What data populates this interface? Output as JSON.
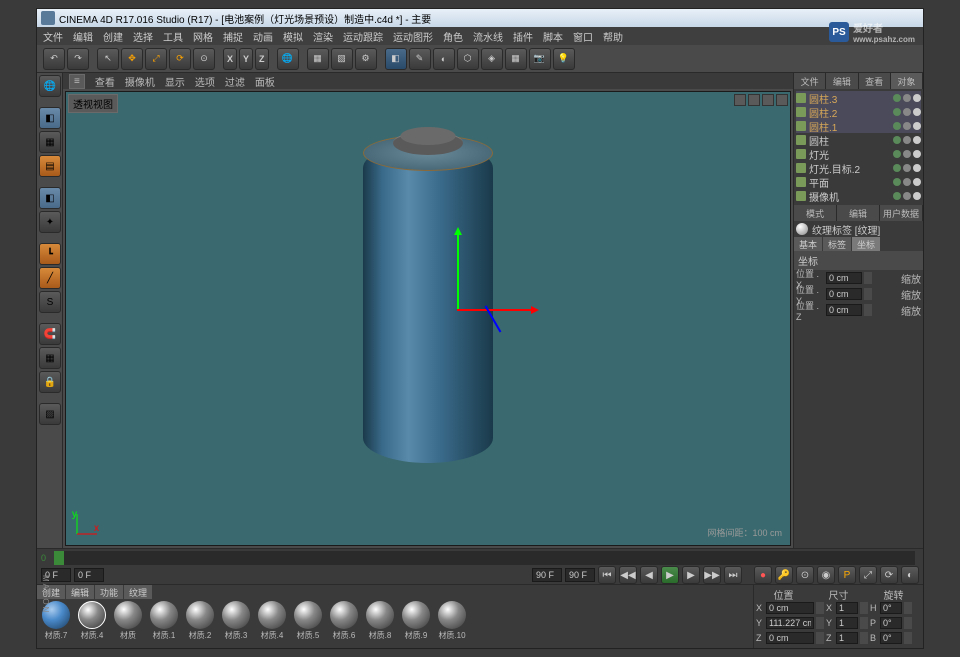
{
  "title": "CINEMA 4D R17.016 Studio (R17) - [电池案例（灯光场景预设）制造中.c4d *] - 主要",
  "menu": [
    "文件",
    "编辑",
    "创建",
    "选择",
    "工具",
    "网格",
    "捕捉",
    "动画",
    "模拟",
    "渲染",
    "运动跟踪",
    "运动图形",
    "角色",
    "流水线",
    "插件",
    "脚本",
    "窗口",
    "帮助"
  ],
  "toolbar_xyz": [
    "X",
    "Y",
    "Z"
  ],
  "viewport": {
    "menu": [
      "查看",
      "摄像机",
      "显示",
      "选项",
      "过滤",
      "面板"
    ],
    "label": "透视视图",
    "grid_label": "网格间距：100 cm"
  },
  "right": {
    "tabs": [
      "文件",
      "编辑",
      "查看",
      "对象"
    ],
    "objects": [
      {
        "name": "圆柱.3",
        "sel": true
      },
      {
        "name": "圆柱.2",
        "sel": true
      },
      {
        "name": "圆柱.1",
        "sel": true
      },
      {
        "name": "圆柱",
        "sel": false
      },
      {
        "name": "灯光",
        "sel": false
      },
      {
        "name": "灯光.目标.2",
        "sel": false
      },
      {
        "name": "平面",
        "sel": false
      },
      {
        "name": "摄像机",
        "sel": false
      }
    ],
    "attr_tabs": [
      "模式",
      "编辑",
      "用户数据"
    ],
    "attr_title": "纹理标签 [纹理]",
    "attr_subtabs": [
      "基本",
      "标签",
      "坐标"
    ],
    "attr_section": "坐标",
    "attr_rows": [
      {
        "l": "位置 . X",
        "v": "0 cm",
        "r": "缩放"
      },
      {
        "l": "位置 . Y",
        "v": "0 cm",
        "r": "缩放"
      },
      {
        "l": "位置 . Z",
        "v": "0 cm",
        "r": "缩放"
      }
    ]
  },
  "timeline": {
    "start_field": "0 F",
    "current": "0",
    "end_field": "90 F",
    "range": "90 F"
  },
  "mat_tabs": [
    "创建",
    "编辑",
    "功能",
    "纹理"
  ],
  "materials": [
    "材质.7",
    "材质.4",
    "材质",
    "材质.1",
    "材质.2",
    "材质.3",
    "材质.4",
    "材质.5",
    "材质.6",
    "材质.8",
    "材质.9",
    "材质.10"
  ],
  "coord": {
    "headers": [
      "位置",
      "尺寸",
      "旋转"
    ],
    "rows": [
      {
        "a": "X",
        "p": "0 cm",
        "s": "X",
        "sv": "1",
        "r": "H",
        "rv": "0°"
      },
      {
        "a": "Y",
        "p": "111.227 cm",
        "s": "Y",
        "sv": "1",
        "r": "P",
        "rv": "0°"
      },
      {
        "a": "Z",
        "p": "0 cm",
        "s": "Z",
        "sv": "1",
        "r": "B",
        "rv": "0°"
      }
    ]
  },
  "watermark": {
    "main": "爱好者",
    "sub": "www.psahz.com",
    "ps": "PS"
  },
  "axon": "MAXON"
}
